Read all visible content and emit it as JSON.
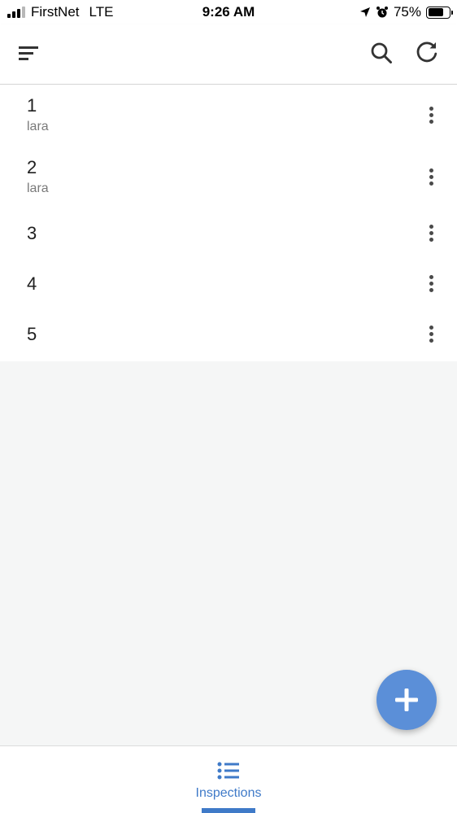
{
  "status_bar": {
    "carrier": "FirstNet",
    "network": "LTE",
    "time": "9:26 AM",
    "battery_percent": "75%",
    "battery_level": 0.75,
    "icons": [
      "signal-icon",
      "location-arrow-icon",
      "alarm-clock-icon",
      "battery-icon"
    ]
  },
  "app_bar": {
    "icons": [
      "sort-menu-icon",
      "search-icon",
      "refresh-icon"
    ]
  },
  "list": {
    "items": [
      {
        "title": "1",
        "subtitle": "lara"
      },
      {
        "title": "2",
        "subtitle": "lara"
      },
      {
        "title": "3",
        "subtitle": ""
      },
      {
        "title": "4",
        "subtitle": ""
      },
      {
        "title": "5",
        "subtitle": ""
      }
    ]
  },
  "fab": {
    "icon": "plus-icon"
  },
  "bottom_nav": {
    "tabs": [
      {
        "label": "Inspections",
        "icon": "list-icon",
        "active": true
      }
    ]
  },
  "colors": {
    "accent": "#3f7ac8",
    "fab": "#5b8fd8",
    "background": "#f5f6f6"
  }
}
